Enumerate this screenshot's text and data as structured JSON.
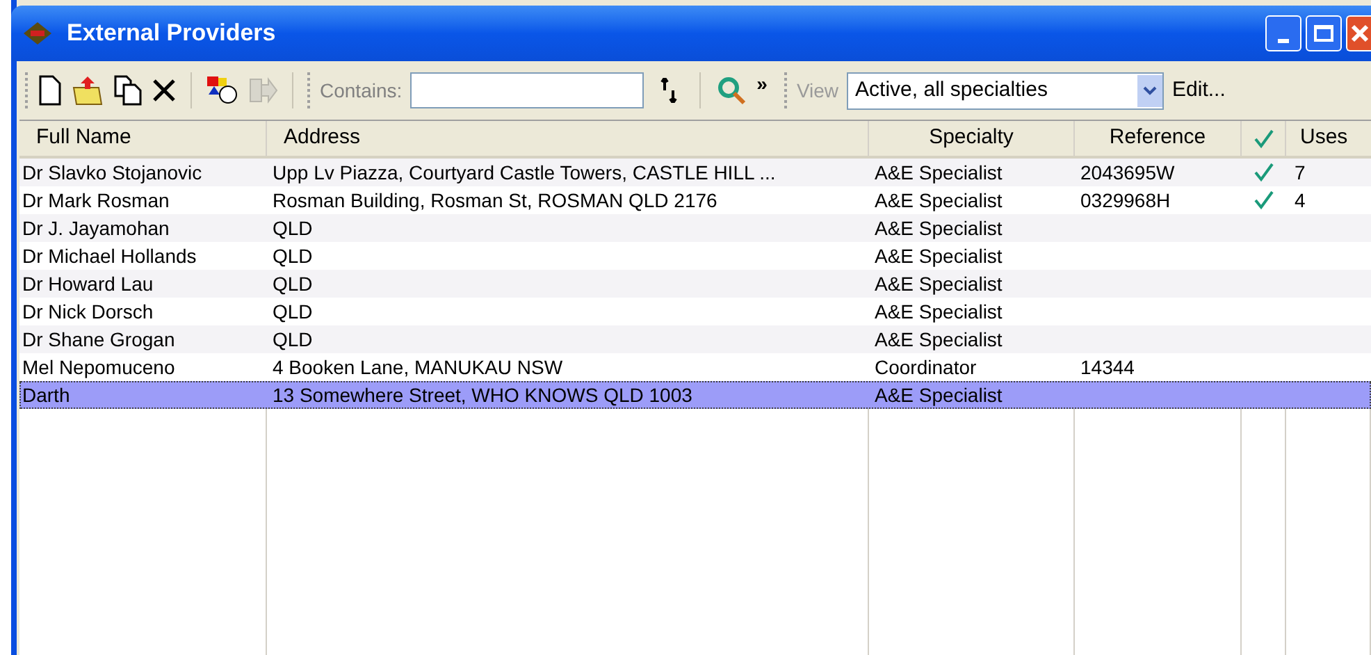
{
  "window": {
    "title": "External Providers"
  },
  "toolbar": {
    "contains_label": "Contains:",
    "more": "»",
    "view_label": "View",
    "view_value": "Active, all specialties",
    "edit": "Edit..."
  },
  "table": {
    "columns": [
      "Full Name",
      "Address",
      "Specialty",
      "Reference",
      "Uses"
    ],
    "rows": [
      {
        "name": "Dr Slavko Stojanovic",
        "address": "Upp Lv Piazza, Courtyard Castle Towers, CASTLE HILL  ...",
        "specialty": "A&E Specialist",
        "reference": "2043695W",
        "checked": true,
        "uses": "7",
        "selected": false
      },
      {
        "name": "Dr Mark Rosman",
        "address": "Rosman Building, Rosman St, ROSMAN  QLD  2176",
        "specialty": "A&E Specialist",
        "reference": "0329968H",
        "checked": true,
        "uses": "4",
        "selected": false
      },
      {
        "name": "Dr J. Jayamohan",
        "address": "QLD",
        "specialty": "A&E Specialist",
        "reference": "",
        "checked": false,
        "uses": "",
        "selected": false
      },
      {
        "name": "Dr Michael Hollands",
        "address": "QLD",
        "specialty": "A&E Specialist",
        "reference": "",
        "checked": false,
        "uses": "",
        "selected": false
      },
      {
        "name": "Dr Howard Lau",
        "address": "QLD",
        "specialty": "A&E Specialist",
        "reference": "",
        "checked": false,
        "uses": "",
        "selected": false
      },
      {
        "name": "Dr Nick Dorsch",
        "address": "QLD",
        "specialty": "A&E Specialist",
        "reference": "",
        "checked": false,
        "uses": "",
        "selected": false
      },
      {
        "name": "Dr Shane Grogan",
        "address": "QLD",
        "specialty": "A&E Specialist",
        "reference": "",
        "checked": false,
        "uses": "",
        "selected": false
      },
      {
        "name": "Mel Nepomuceno",
        "address": "4 Booken Lane, MANUKAU  NSW",
        "specialty": "Coordinator",
        "reference": "14344",
        "checked": false,
        "uses": "",
        "selected": false
      },
      {
        "name": "Darth",
        "address": "13 Somewhere Street, WHO KNOWS  QLD  1003",
        "specialty": "A&E Specialist",
        "reference": "",
        "checked": false,
        "uses": "",
        "selected": true
      }
    ]
  }
}
